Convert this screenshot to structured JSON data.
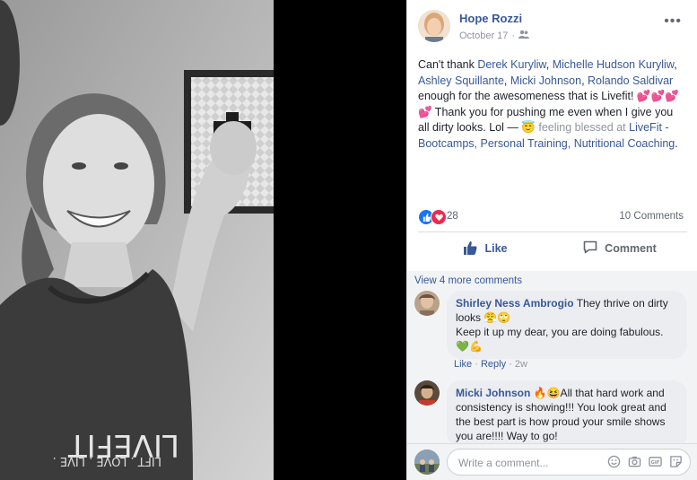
{
  "post": {
    "author": "Hope Rozzi",
    "date": "October 17",
    "dot": "·",
    "privacy_icon": "friends-icon",
    "text": {
      "p1": "Can't thank ",
      "tag1": "Derek Kuryliw",
      "sep1": ", ",
      "tag2": "Michelle Hudson Kuryliw",
      "sep2": ", ",
      "tag3": "Ashley Squillante",
      "sep3": ", ",
      "tag4": "Micki Johnson",
      "sep4": ", ",
      "tag5": "Rolando Saldivar",
      "p2": " enough for the awesomeness that is Livefit! 💕💕💕💕 Thank you for pushing me even when I give you all dirty looks. Lol — 😇 ",
      "feeling": "feeling blessed at ",
      "place": "LiveFit - Bootcamps, Personal Training, Nutritional Coaching",
      "end": "."
    }
  },
  "stats": {
    "reaction_count": "28",
    "comments_count": "10 Comments"
  },
  "actions": {
    "like": "Like",
    "comment": "Comment"
  },
  "comments": {
    "view_more": "View 4 more comments",
    "items": [
      {
        "name": "Shirley Ness Ambrogio",
        "text1": " They thrive on dirty looks 😤🙄",
        "text2": "Keep it up my dear, you are doing fabulous. 💚💪",
        "like": "Like",
        "dot": "·",
        "reply": "Reply",
        "time": "2w"
      },
      {
        "name": "Micki Johnson",
        "text1": " 🔥😆All that hard work and consistency is showing!!! You look great and the best part is how proud your smile shows you are!!!! Way to go!"
      }
    ]
  },
  "composer": {
    "placeholder": "Write a comment...",
    "icons": [
      "emoji-icon",
      "camera-icon",
      "gif-icon",
      "sticker-icon"
    ]
  },
  "colors": {
    "link": "#385898",
    "like_blue": "#1877f2",
    "love_red": "#f0284a"
  }
}
